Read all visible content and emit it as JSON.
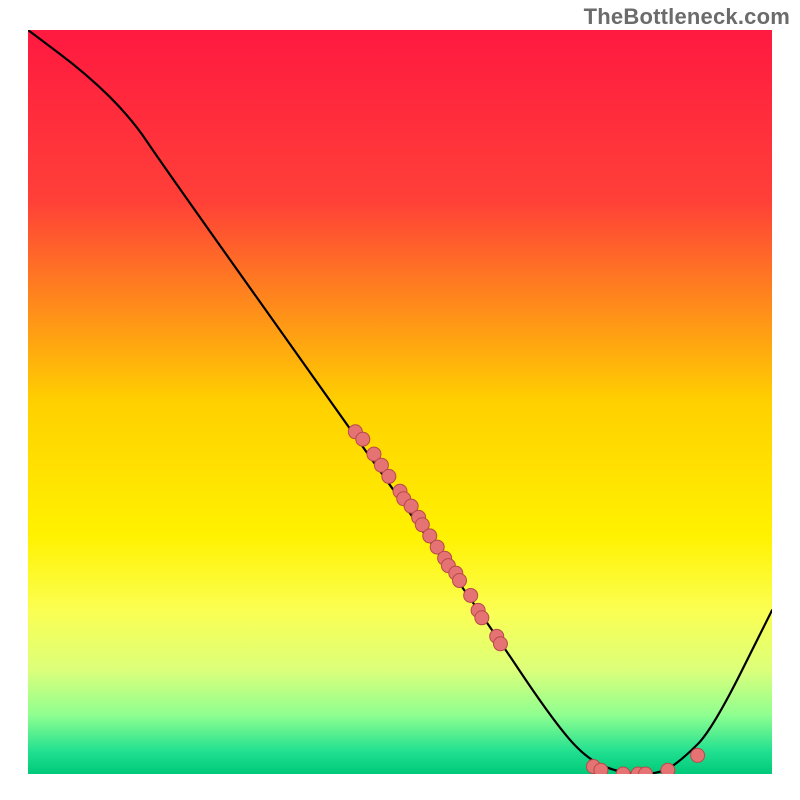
{
  "watermark": "TheBottleneck.com",
  "chart_data": {
    "type": "line",
    "title": "",
    "xlabel": "",
    "ylabel": "",
    "xlim": [
      0,
      100
    ],
    "ylim": [
      0,
      100
    ],
    "gradient_stops": [
      {
        "offset": 0,
        "color": "#ff1940"
      },
      {
        "offset": 23,
        "color": "#ff4038"
      },
      {
        "offset": 50,
        "color": "#ffd000"
      },
      {
        "offset": 68,
        "color": "#fff200"
      },
      {
        "offset": 78,
        "color": "#fbff52"
      },
      {
        "offset": 86,
        "color": "#dcff7a"
      },
      {
        "offset": 92,
        "color": "#90ff90"
      },
      {
        "offset": 97,
        "color": "#20e090"
      },
      {
        "offset": 100,
        "color": "#00c97a"
      }
    ],
    "curve": [
      {
        "x": 0,
        "y": 100
      },
      {
        "x": 8,
        "y": 94
      },
      {
        "x": 14,
        "y": 88
      },
      {
        "x": 18,
        "y": 82
      },
      {
        "x": 45,
        "y": 44
      },
      {
        "x": 62,
        "y": 20
      },
      {
        "x": 70,
        "y": 8
      },
      {
        "x": 75,
        "y": 2
      },
      {
        "x": 80,
        "y": 0
      },
      {
        "x": 85,
        "y": 0
      },
      {
        "x": 88,
        "y": 2
      },
      {
        "x": 92,
        "y": 6
      },
      {
        "x": 100,
        "y": 22
      }
    ],
    "curve_color": "#000000",
    "point_fill": "#e57373",
    "point_stroke": "#b84a4a",
    "points": [
      {
        "x": 44,
        "y": 46
      },
      {
        "x": 45,
        "y": 45
      },
      {
        "x": 46.5,
        "y": 43
      },
      {
        "x": 47.5,
        "y": 41.5
      },
      {
        "x": 48.5,
        "y": 40
      },
      {
        "x": 50,
        "y": 38
      },
      {
        "x": 50.5,
        "y": 37
      },
      {
        "x": 51.5,
        "y": 36
      },
      {
        "x": 52.5,
        "y": 34.5
      },
      {
        "x": 53,
        "y": 33.5
      },
      {
        "x": 54,
        "y": 32
      },
      {
        "x": 55,
        "y": 30.5
      },
      {
        "x": 56,
        "y": 29
      },
      {
        "x": 56.5,
        "y": 28
      },
      {
        "x": 57.5,
        "y": 27
      },
      {
        "x": 58,
        "y": 26
      },
      {
        "x": 59.5,
        "y": 24
      },
      {
        "x": 60.5,
        "y": 22
      },
      {
        "x": 61,
        "y": 21
      },
      {
        "x": 63,
        "y": 18.5
      },
      {
        "x": 63.5,
        "y": 17.5
      },
      {
        "x": 76,
        "y": 1
      },
      {
        "x": 77,
        "y": 0.5
      },
      {
        "x": 80,
        "y": 0
      },
      {
        "x": 82,
        "y": 0
      },
      {
        "x": 83,
        "y": 0
      },
      {
        "x": 86,
        "y": 0.5
      },
      {
        "x": 90,
        "y": 2.5
      }
    ]
  }
}
